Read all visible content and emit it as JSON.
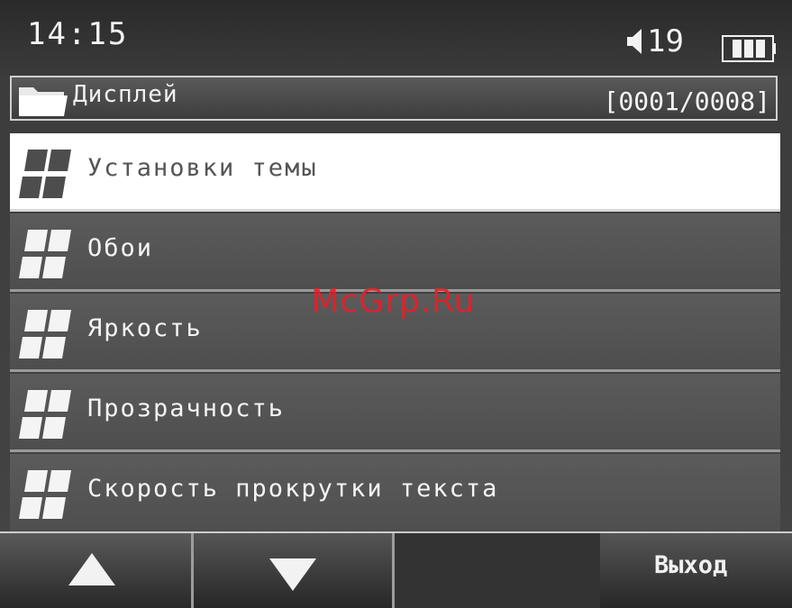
{
  "status": {
    "time": "14:15",
    "volume": "19",
    "battery_icon": "battery-full-icon"
  },
  "header": {
    "title": "Дисплей",
    "counter": "[0001/0008]",
    "icon": "folder-icon"
  },
  "menu": {
    "items": [
      {
        "label": "Установки темы",
        "selected": true
      },
      {
        "label": "Обои",
        "selected": false
      },
      {
        "label": "Яркость",
        "selected": false
      },
      {
        "label": "Прозрачность",
        "selected": false
      },
      {
        "label": "Скорость прокрутки текста",
        "selected": false
      }
    ]
  },
  "softkeys": {
    "up_icon": "arrow-up-icon",
    "down_icon": "arrow-down-icon",
    "exit_label": "Выход"
  },
  "watermark": "McGrp.Ru"
}
